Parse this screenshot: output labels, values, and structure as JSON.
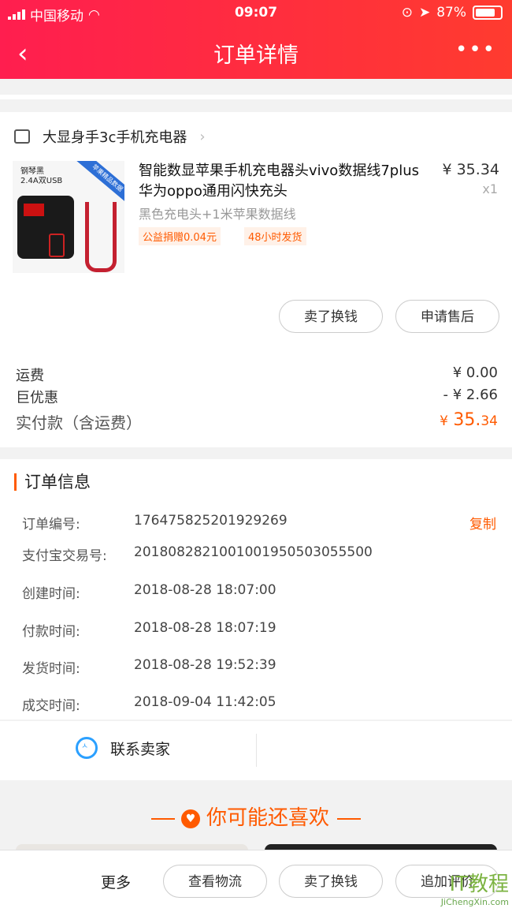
{
  "status": {
    "carrier": "中国移动",
    "time": "09:07",
    "battery": "87%"
  },
  "nav": {
    "back": "‹",
    "title": "订单详情",
    "more": "•••"
  },
  "shop": {
    "name": "大显身手3c手机充电器"
  },
  "product": {
    "thumb_line1": "钢琴黑",
    "thumb_line2": "2.4A双USB",
    "thumb_ribbon": "苹果精品数据",
    "title": "智能数显苹果手机充电器头vivo数据线7plus华为oppo通用闪快充头",
    "price": "¥ 35.34",
    "qty": "x1",
    "sku": "黑色充电头+1米苹果数据线",
    "tags": [
      "公益捐赠0.04元",
      "48小时发货"
    ]
  },
  "actions": {
    "sell": "卖了换钱",
    "aftersale": "申请售后"
  },
  "fees": {
    "shipping_label": "运费",
    "shipping_value": "¥ 0.00",
    "discount_label": "巨优惠",
    "discount_value": "- ¥ 2.66",
    "paid_label": "实付款（含运费）",
    "paid_currency": "¥",
    "paid_int": "35.",
    "paid_dec": "34"
  },
  "order": {
    "title": "订单信息",
    "copy": "复制",
    "rows": [
      {
        "label": "订单编号:",
        "value": "176475825201929269"
      },
      {
        "label": "支付宝交易号:",
        "value": "2018082821001001950503055500"
      },
      {
        "label": "创建时间:",
        "value": "2018-08-28 18:07:00"
      },
      {
        "label": "付款时间:",
        "value": "2018-08-28 18:07:19"
      },
      {
        "label": "发货时间:",
        "value": "2018-08-28 19:52:39"
      },
      {
        "label": "成交时间:",
        "value": "2018-09-04 11:42:05"
      }
    ]
  },
  "contact": {
    "label": "联系卖家"
  },
  "like": {
    "title": "你可能还喜欢"
  },
  "bottom": {
    "more": "更多",
    "logistics": "查看物流",
    "sell": "卖了换钱",
    "review": "追加评价"
  },
  "watermark": {
    "big": "IT教程",
    "small": "JiChengXin.com"
  },
  "colors": {
    "accent": "#ff5a00",
    "header": "#ff2a45"
  }
}
